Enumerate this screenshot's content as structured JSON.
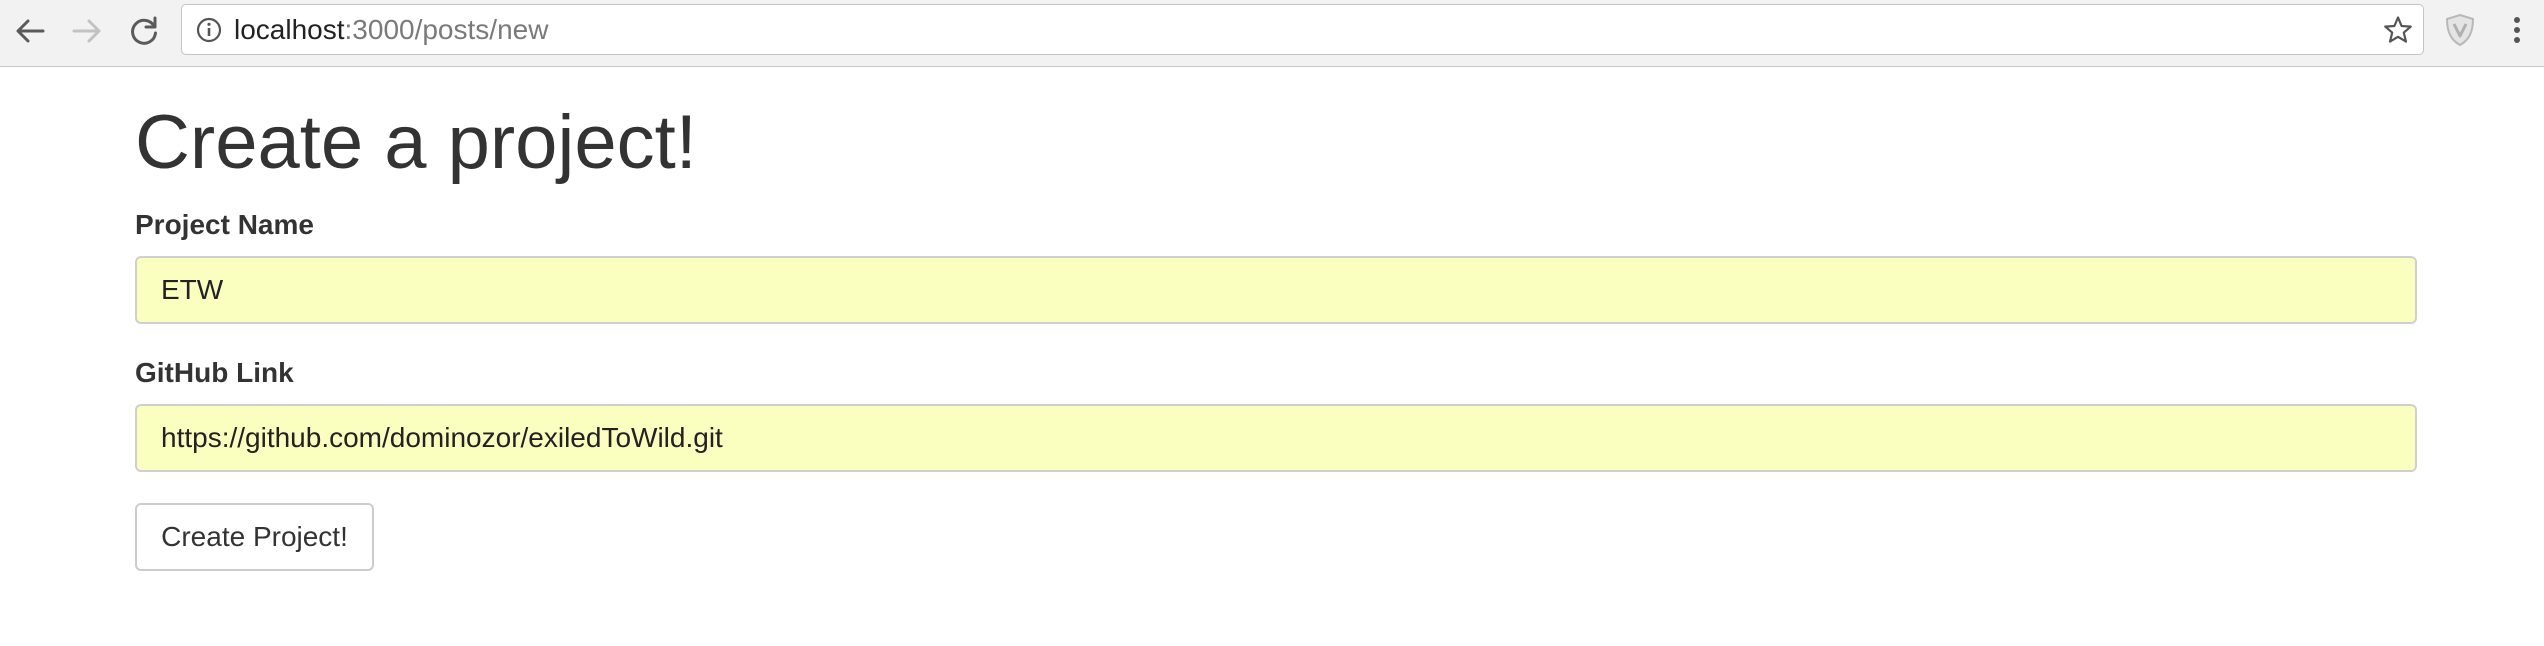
{
  "browser": {
    "url_host": "localhost",
    "url_path": ":3000/posts/new",
    "icons": {
      "back": "back-arrow-icon",
      "forward": "forward-arrow-icon",
      "reload": "reload-icon",
      "info": "info-icon",
      "bookmark": "star-icon",
      "extension": "shield-extension-icon",
      "menu": "kebab-menu-icon"
    }
  },
  "page": {
    "title": "Create a project!",
    "form": {
      "project_name_label": "Project Name",
      "project_name_value": "ETW",
      "github_link_label": "GitHub Link",
      "github_link_value": "https://github.com/dominozor/exiledToWild.git",
      "submit_label": "Create Project!"
    }
  },
  "colors": {
    "autofill_background": "#fafebf",
    "text": "#333333",
    "toolbar_background": "#f2f2f2"
  }
}
